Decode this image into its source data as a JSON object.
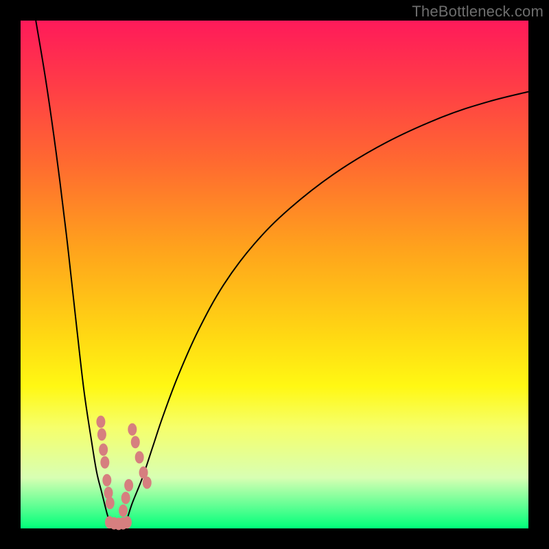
{
  "watermark": "TheBottleneck.com",
  "colors": {
    "frame_bg": "#000000",
    "curve": "#000000",
    "marker": "#d67f7f",
    "gradient_top": "#ff1a5a",
    "gradient_bottom": "#00ff7a"
  },
  "chart_data": {
    "type": "line",
    "title": "",
    "xlabel": "",
    "ylabel": "",
    "xlim": [
      0,
      100
    ],
    "ylim": [
      0,
      100
    ],
    "series": [
      {
        "name": "left",
        "x": [
          3,
          5,
          7,
          9,
          11,
          12.5,
          14,
          15,
          16,
          17,
          17.5,
          18
        ],
        "y": [
          100,
          88,
          74,
          58,
          40,
          27,
          17,
          11,
          7,
          3,
          1.5,
          0
        ]
      },
      {
        "name": "right",
        "x": [
          20,
          21,
          22,
          24,
          26,
          28,
          31,
          35,
          40,
          46,
          53,
          62,
          72,
          83,
          92,
          100
        ],
        "y": [
          0,
          2,
          5,
          10,
          16,
          22,
          30,
          39,
          48,
          56,
          63,
          70,
          76,
          81,
          84,
          86
        ]
      }
    ],
    "markers": [
      {
        "series": "left",
        "points": [
          {
            "x": 15.8,
            "y": 21
          },
          {
            "x": 16.0,
            "y": 18.5
          },
          {
            "x": 16.3,
            "y": 15.5
          },
          {
            "x": 16.6,
            "y": 13
          },
          {
            "x": 17.0,
            "y": 9.5
          },
          {
            "x": 17.3,
            "y": 7
          },
          {
            "x": 17.6,
            "y": 5
          }
        ]
      },
      {
        "series": "right",
        "points": [
          {
            "x": 22.0,
            "y": 19.5
          },
          {
            "x": 22.6,
            "y": 17
          },
          {
            "x": 23.4,
            "y": 14
          },
          {
            "x": 24.2,
            "y": 11
          },
          {
            "x": 21.3,
            "y": 8.5
          },
          {
            "x": 24.9,
            "y": 9
          },
          {
            "x": 20.7,
            "y": 6
          },
          {
            "x": 20.2,
            "y": 3.5
          }
        ]
      },
      {
        "series": "bottom",
        "points": [
          {
            "x": 17.5,
            "y": 1.2
          },
          {
            "x": 18.4,
            "y": 1.0
          },
          {
            "x": 19.3,
            "y": 0.9
          },
          {
            "x": 20.2,
            "y": 1.0
          },
          {
            "x": 21.0,
            "y": 1.2
          }
        ]
      }
    ]
  }
}
